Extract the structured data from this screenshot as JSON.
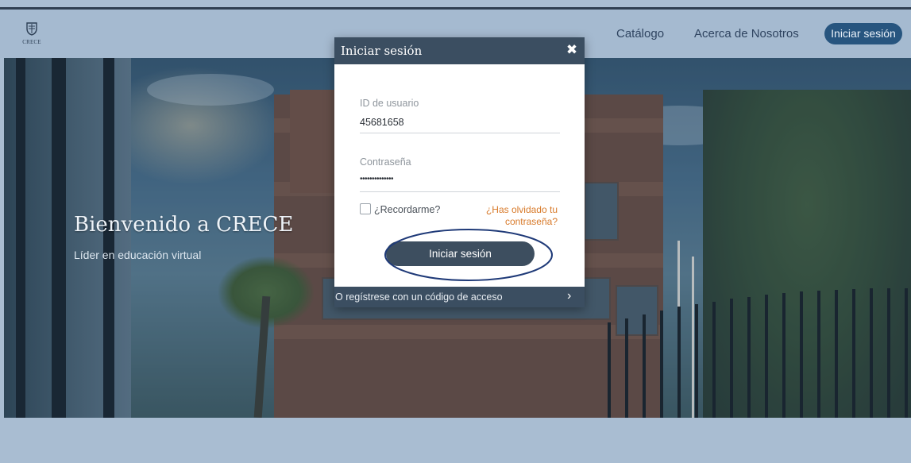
{
  "colors": {
    "header_bg": "#a5bad0",
    "accent": "#27557f",
    "modal_header": "#3b4e61",
    "link": "#d87a2a",
    "highlight_ring": "#1f3a78"
  },
  "header": {
    "logo_text": "CRECE",
    "nav": {
      "catalog": "Catálogo",
      "about": "Acerca de Nosotros",
      "login": "Iniciar sesión"
    }
  },
  "hero": {
    "title": "Bienvenido a CRECE",
    "subtitle": "Líder en educación virtual"
  },
  "modal": {
    "title": "Iniciar sesión",
    "close_icon": "close-icon",
    "user_label": "ID de usuario",
    "user_value": "45681658",
    "password_label": "Contraseña",
    "password_value": "••••••••••••••",
    "remember_label": "¿Recordarme?",
    "forgot_line1": "¿Has olvidado tu",
    "forgot_line2": "contraseña?",
    "submit_label": "Iniciar sesión",
    "register_text": "O regístrese con un código de acceso",
    "register_icon": "chevron-right-icon"
  }
}
